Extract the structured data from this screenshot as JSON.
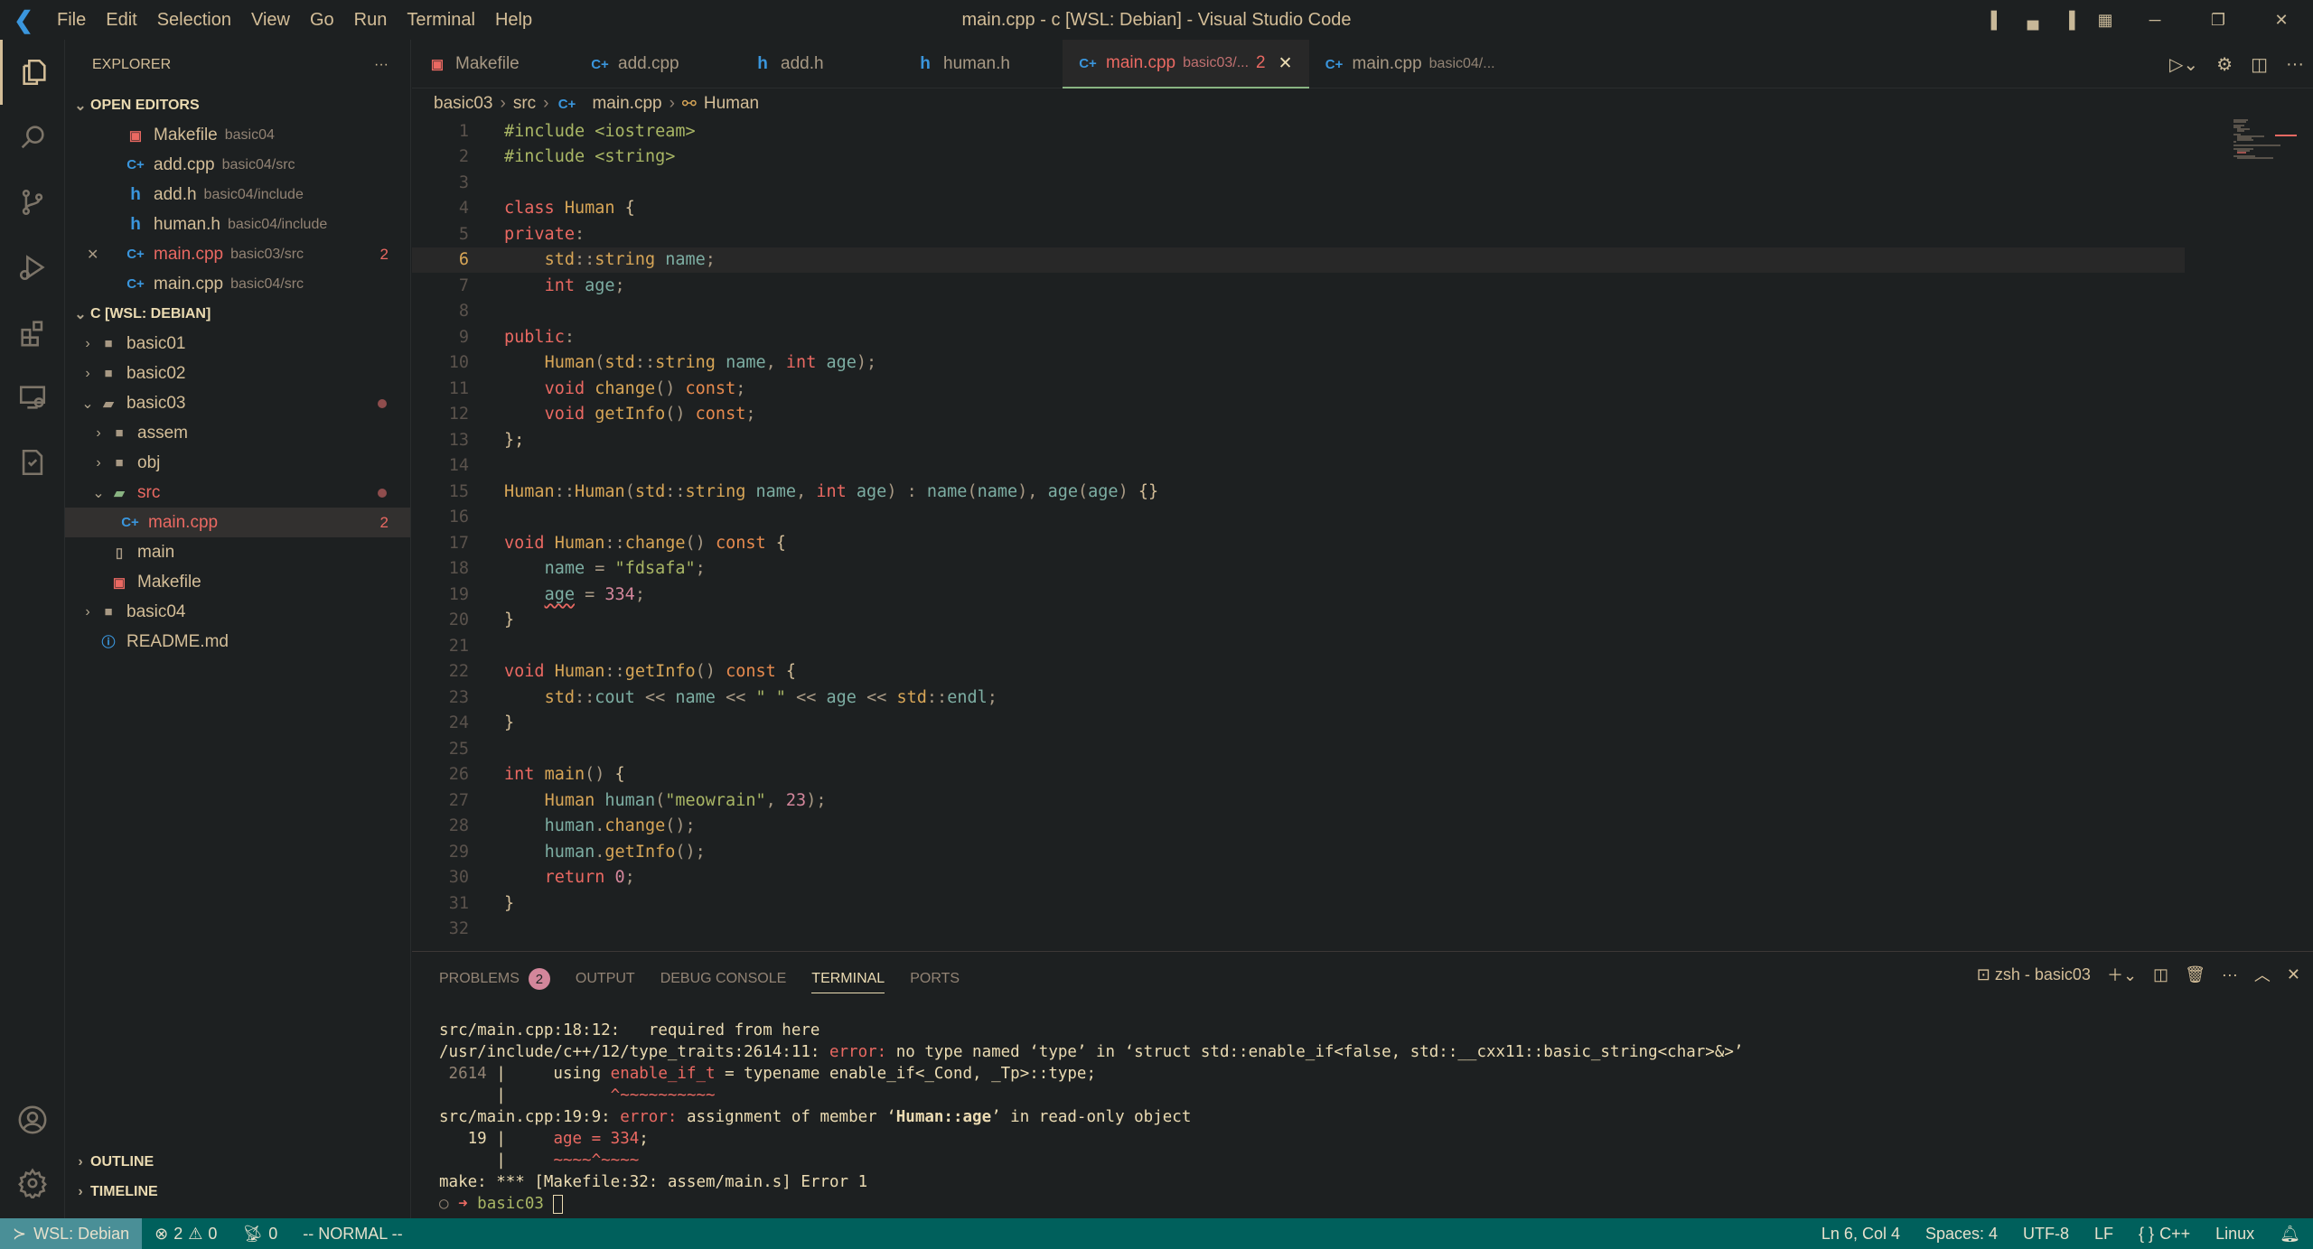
{
  "titlebar": {
    "menu": [
      "File",
      "Edit",
      "Selection",
      "View",
      "Go",
      "Run",
      "Terminal",
      "Help"
    ],
    "title": "main.cpp - c [WSL: Debian] - Visual Studio Code"
  },
  "sidebar": {
    "title": "EXPLORER",
    "open_editors": {
      "label": "OPEN EDITORS",
      "items": [
        {
          "icon": "makefile-icon",
          "name": "Makefile",
          "desc": "basic04"
        },
        {
          "icon": "cpp-icon",
          "name": "add.cpp",
          "desc": "basic04/src"
        },
        {
          "icon": "h-icon",
          "name": "add.h",
          "desc": "basic04/include"
        },
        {
          "icon": "h-icon",
          "name": "human.h",
          "desc": "basic04/include"
        },
        {
          "icon": "cpp-icon",
          "name": "main.cpp",
          "desc": "basic03/src",
          "badge": "2",
          "active": true
        },
        {
          "icon": "cpp-icon",
          "name": "main.cpp",
          "desc": "basic04/src"
        }
      ]
    },
    "workspace": {
      "label": "C [WSL: DEBIAN]",
      "items": [
        {
          "name": "basic01",
          "type": "folder",
          "depth": 0
        },
        {
          "name": "basic02",
          "type": "folder",
          "depth": 0
        },
        {
          "name": "basic03",
          "type": "folder-open",
          "depth": 0,
          "dot": true
        },
        {
          "name": "assem",
          "type": "folder",
          "depth": 1
        },
        {
          "name": "obj",
          "type": "folder",
          "depth": 1
        },
        {
          "name": "src",
          "type": "folder-src",
          "depth": 1,
          "dot": true
        },
        {
          "name": "main.cpp",
          "type": "cpp",
          "depth": 2,
          "badge": "2",
          "selected": true
        },
        {
          "name": "main",
          "type": "file",
          "depth": 1
        },
        {
          "name": "Makefile",
          "type": "makefile",
          "depth": 1
        },
        {
          "name": "basic04",
          "type": "folder",
          "depth": 0
        },
        {
          "name": "README.md",
          "type": "info",
          "depth": 0
        }
      ]
    },
    "outline": "OUTLINE",
    "timeline": "TIMELINE"
  },
  "tabs": [
    {
      "icon": "makefile-icon",
      "name": "Makefile"
    },
    {
      "icon": "cpp-icon",
      "name": "add.cpp"
    },
    {
      "icon": "h-icon",
      "name": "add.h"
    },
    {
      "icon": "h-icon",
      "name": "human.h"
    },
    {
      "icon": "cpp-icon",
      "name": "main.cpp",
      "desc": "basic03/...",
      "badge": "2",
      "active": true
    },
    {
      "icon": "cpp-icon",
      "name": "main.cpp",
      "desc": "basic04/..."
    }
  ],
  "breadcrumb": [
    "basic03",
    "src",
    "main.cpp",
    "Human"
  ],
  "editor": {
    "current_line": 6,
    "lines": [
      [
        [
          "pre",
          "#include "
        ],
        [
          "str",
          "<iostream>"
        ]
      ],
      [
        [
          "pre",
          "#include "
        ],
        [
          "str",
          "<string>"
        ]
      ],
      [],
      [
        [
          "kw",
          "class "
        ],
        [
          "ty",
          "Human "
        ],
        [
          "tx",
          "{"
        ]
      ],
      [
        [
          "kw",
          "private"
        ],
        [
          "p",
          ":"
        ]
      ],
      [
        [
          "tx",
          "    "
        ],
        [
          "ty",
          "std"
        ],
        [
          "p",
          "::"
        ],
        [
          "ty",
          "string "
        ],
        [
          "var",
          "name"
        ],
        [
          "p",
          ";"
        ]
      ],
      [
        [
          "tx",
          "    "
        ],
        [
          "kw",
          "int "
        ],
        [
          "var",
          "age"
        ],
        [
          "p",
          ";"
        ]
      ],
      [],
      [
        [
          "kw",
          "public"
        ],
        [
          "p",
          ":"
        ]
      ],
      [
        [
          "tx",
          "    "
        ],
        [
          "fn",
          "Human"
        ],
        [
          "p",
          "("
        ],
        [
          "ty",
          "std"
        ],
        [
          "p",
          "::"
        ],
        [
          "ty",
          "string "
        ],
        [
          "var",
          "name"
        ],
        [
          "p",
          ", "
        ],
        [
          "kw",
          "int "
        ],
        [
          "var",
          "age"
        ],
        [
          "p",
          ");"
        ]
      ],
      [
        [
          "tx",
          "    "
        ],
        [
          "kw",
          "void "
        ],
        [
          "fn",
          "change"
        ],
        [
          "p",
          "() "
        ],
        [
          "cn",
          "const"
        ],
        [
          "p",
          ";"
        ]
      ],
      [
        [
          "tx",
          "    "
        ],
        [
          "kw",
          "void "
        ],
        [
          "fn",
          "getInfo"
        ],
        [
          "p",
          "() "
        ],
        [
          "cn",
          "const"
        ],
        [
          "p",
          ";"
        ]
      ],
      [
        [
          "tx",
          "};"
        ]
      ],
      [],
      [
        [
          "ty",
          "Human"
        ],
        [
          "p",
          "::"
        ],
        [
          "fn",
          "Human"
        ],
        [
          "p",
          "("
        ],
        [
          "ty",
          "std"
        ],
        [
          "p",
          "::"
        ],
        [
          "ty",
          "string "
        ],
        [
          "var",
          "name"
        ],
        [
          "p",
          ", "
        ],
        [
          "kw",
          "int "
        ],
        [
          "var",
          "age"
        ],
        [
          "p",
          ") : "
        ],
        [
          "var",
          "name"
        ],
        [
          "p",
          "("
        ],
        [
          "var",
          "name"
        ],
        [
          "p",
          "), "
        ],
        [
          "var",
          "age"
        ],
        [
          "p",
          "("
        ],
        [
          "var",
          "age"
        ],
        [
          "p",
          ") "
        ],
        [
          "tx",
          "{}"
        ]
      ],
      [],
      [
        [
          "kw",
          "void "
        ],
        [
          "ty",
          "Human"
        ],
        [
          "p",
          "::"
        ],
        [
          "fn",
          "change"
        ],
        [
          "p",
          "() "
        ],
        [
          "cn",
          "const "
        ],
        [
          "tx",
          "{"
        ]
      ],
      [
        [
          "tx",
          "    "
        ],
        [
          "var",
          "name "
        ],
        [
          "p",
          "= "
        ],
        [
          "str",
          "\"fdsafa\""
        ],
        [
          "p",
          ";"
        ]
      ],
      [
        [
          "tx",
          "    "
        ],
        [
          "var sq",
          "age"
        ],
        [
          "p",
          " = "
        ],
        [
          "nm",
          "334"
        ],
        [
          "p",
          ";"
        ]
      ],
      [
        [
          "tx",
          "}"
        ]
      ],
      [],
      [
        [
          "kw",
          "void "
        ],
        [
          "ty",
          "Human"
        ],
        [
          "p",
          "::"
        ],
        [
          "fn",
          "getInfo"
        ],
        [
          "p",
          "() "
        ],
        [
          "cn",
          "const "
        ],
        [
          "tx",
          "{"
        ]
      ],
      [
        [
          "tx",
          "    "
        ],
        [
          "ty",
          "std"
        ],
        [
          "p",
          "::"
        ],
        [
          "var",
          "cout "
        ],
        [
          "p",
          "<< "
        ],
        [
          "var",
          "name "
        ],
        [
          "p",
          "<< "
        ],
        [
          "str",
          "\" \" "
        ],
        [
          "p",
          "<< "
        ],
        [
          "var",
          "age "
        ],
        [
          "p",
          "<< "
        ],
        [
          "ty",
          "std"
        ],
        [
          "p",
          "::"
        ],
        [
          "var",
          "endl"
        ],
        [
          "p",
          ";"
        ]
      ],
      [
        [
          "tx",
          "}"
        ]
      ],
      [],
      [
        [
          "kw",
          "int "
        ],
        [
          "fn",
          "main"
        ],
        [
          "p",
          "() "
        ],
        [
          "tx",
          "{"
        ]
      ],
      [
        [
          "tx",
          "    "
        ],
        [
          "ty",
          "Human "
        ],
        [
          "var",
          "human"
        ],
        [
          "p",
          "("
        ],
        [
          "str",
          "\"meowrain\""
        ],
        [
          "p",
          ", "
        ],
        [
          "nm",
          "23"
        ],
        [
          "p",
          ");"
        ]
      ],
      [
        [
          "tx",
          "    "
        ],
        [
          "var",
          "human"
        ],
        [
          "p",
          "."
        ],
        [
          "fn",
          "change"
        ],
        [
          "p",
          "();"
        ]
      ],
      [
        [
          "tx",
          "    "
        ],
        [
          "var",
          "human"
        ],
        [
          "p",
          "."
        ],
        [
          "fn",
          "getInfo"
        ],
        [
          "p",
          "();"
        ]
      ],
      [
        [
          "tx",
          "    "
        ],
        [
          "kw",
          "return "
        ],
        [
          "nm",
          "0"
        ],
        [
          "p",
          ";"
        ]
      ],
      [
        [
          "tx",
          "}"
        ]
      ],
      []
    ]
  },
  "panel": {
    "tabs": [
      {
        "label": "PROBLEMS",
        "badge": "2"
      },
      {
        "label": "OUTPUT"
      },
      {
        "label": "DEBUG CONSOLE"
      },
      {
        "label": "TERMINAL",
        "active": true
      },
      {
        "label": "PORTS"
      }
    ],
    "terminal_name": "zsh - basic03",
    "terminal": [
      [
        [
          "",
          "src/main.cpp:18:12:   required from here"
        ]
      ],
      [
        [
          "",
          "/usr/include/c++/12/type_traits:2614:11: "
        ],
        [
          "e",
          "error: "
        ],
        [
          "",
          "no type named ‘type’ in ‘struct std::enable_if<false, std::__cxx11::basic_string<char>&>’"
        ]
      ],
      [
        [
          "",
          ""
        ],
        [
          "m",
          " 2614 "
        ],
        [
          "",
          "|     using "
        ],
        [
          "e",
          "enable_if_t"
        ],
        [
          "",
          " = typename enable_if<_Cond, _Tp>::type;"
        ]
      ],
      [
        [
          "",
          "      |           "
        ],
        [
          "e",
          "^~~~~~~~~~~"
        ]
      ],
      [
        [
          "",
          "src/main.cpp:19:9: "
        ],
        [
          "e",
          "error: "
        ],
        [
          "",
          "assignment of member ‘"
        ],
        [
          "b",
          "Human::age"
        ],
        [
          "",
          "’ in read-only object"
        ]
      ],
      [
        [
          "",
          "   19 |     "
        ],
        [
          "e",
          "age = 334"
        ],
        [
          "",
          ";"
        ]
      ],
      [
        [
          "",
          "      |     "
        ],
        [
          "e",
          "~~~~^~~~~"
        ]
      ],
      [
        [
          "",
          "make: *** [Makefile:32: assem/main.s] Error 1"
        ]
      ]
    ],
    "prompt": "basic03"
  },
  "statusbar": {
    "remote": "WSL: Debian",
    "errors": "2",
    "warnings": "0",
    "ports": "0",
    "mode": "-- NORMAL --",
    "position": "Ln 6, Col 4",
    "spaces": "Spaces: 4",
    "encoding": "UTF-8",
    "eol": "LF",
    "language": "C++",
    "os": "Linux"
  },
  "colors": {
    "status_bar": "#00605c",
    "remote": "#4a8f97",
    "error": "#ea6962",
    "background": "#1d2021"
  }
}
